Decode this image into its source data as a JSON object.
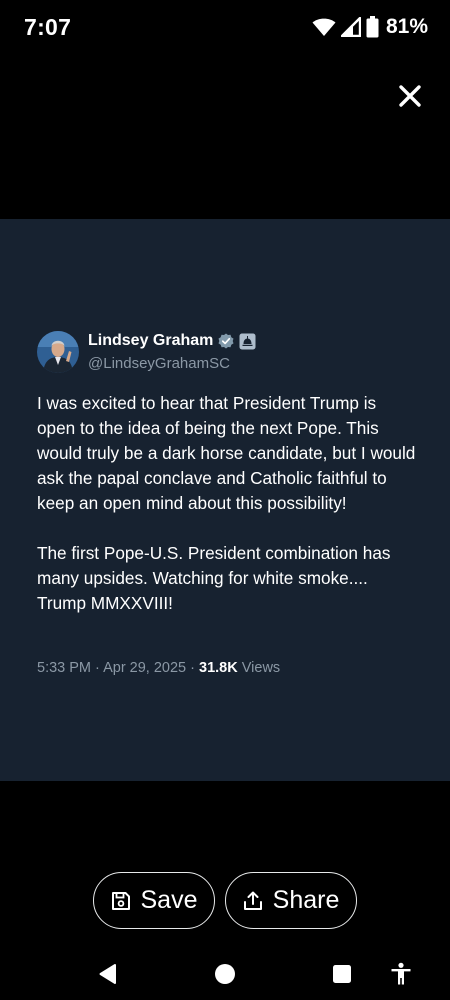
{
  "status_bar": {
    "time": "7:07",
    "battery_percent": "81%"
  },
  "tweet": {
    "author_name": "Lindsey Graham",
    "author_handle": "@LindseyGrahamSC",
    "body": "I was excited to hear that President Trump is open to the idea of being the next Pope. This would truly be a dark horse candidate, but I would ask the papal conclave and Catholic faithful to keep an open mind about this possibility!\n\nThe first Pope-U.S. President combination has many upsides. Watching for white smoke.... Trump MMXXVIII!",
    "timestamp": "5:33 PM · Apr 29, 2025 · ",
    "views_count": "31.8K",
    "views_label": " Views"
  },
  "actions": {
    "save_label": "Save",
    "share_label": "Share"
  },
  "colors": {
    "card_background": "#172230",
    "verified_badge": "#829aab",
    "gov_label": "#aebdcc",
    "muted_text": "#8b98a5"
  },
  "icons": [
    "close-icon",
    "wifi-icon",
    "signal-icon",
    "battery-icon",
    "verified-badge-icon",
    "government-label-icon",
    "bookmark-save-icon",
    "share-upload-icon",
    "nav-back-icon",
    "nav-home-icon",
    "nav-recents-icon",
    "accessibility-icon"
  ]
}
